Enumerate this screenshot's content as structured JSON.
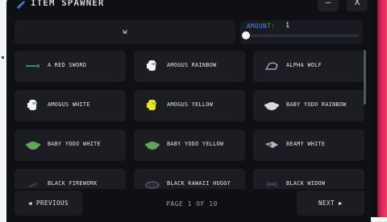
{
  "window": {
    "title": "ITEM SPAWNER",
    "minimize_label": "–",
    "close_label": "X"
  },
  "search": {
    "value": "w"
  },
  "amount": {
    "label": "AMOUNT:",
    "value": "1",
    "slider_fraction": 0.0
  },
  "items": [
    {
      "label": "A RED SWORD",
      "icon": "sword-icon"
    },
    {
      "label": "AMOGUS RAINBOW",
      "icon": "amogus-icon"
    },
    {
      "label": "ALPHA WOLF",
      "icon": "wolf-icon"
    },
    {
      "label": "AMOGUS WHITE",
      "icon": "amogus-icon"
    },
    {
      "label": "AMOGUS YELLOW",
      "icon": "amogus-icon"
    },
    {
      "label": "BABY YODO RAINBOW",
      "icon": "baby-yodo-icon"
    },
    {
      "label": "BABY YODO WHITE",
      "icon": "baby-yodo-icon"
    },
    {
      "label": "BABY YODO YELLOW",
      "icon": "baby-yodo-icon"
    },
    {
      "label": "BEAMY WHITE",
      "icon": "beamy-icon"
    },
    {
      "label": "BLACK FIREWORK",
      "icon": "firework-icon"
    },
    {
      "label": "BLACK KAWAII HUGGY",
      "icon": "huggy-icon"
    },
    {
      "label": "BLACK WIDOW",
      "icon": "spider-icon"
    }
  ],
  "pagination": {
    "previous_label": "◀ PREVIOUS",
    "page_text": "PAGE 1 OF 10",
    "next_label": "NEXT ▶"
  },
  "colors": {
    "background": "#0f1014",
    "card": "#1c1d23",
    "accent": "#4a8df0"
  }
}
